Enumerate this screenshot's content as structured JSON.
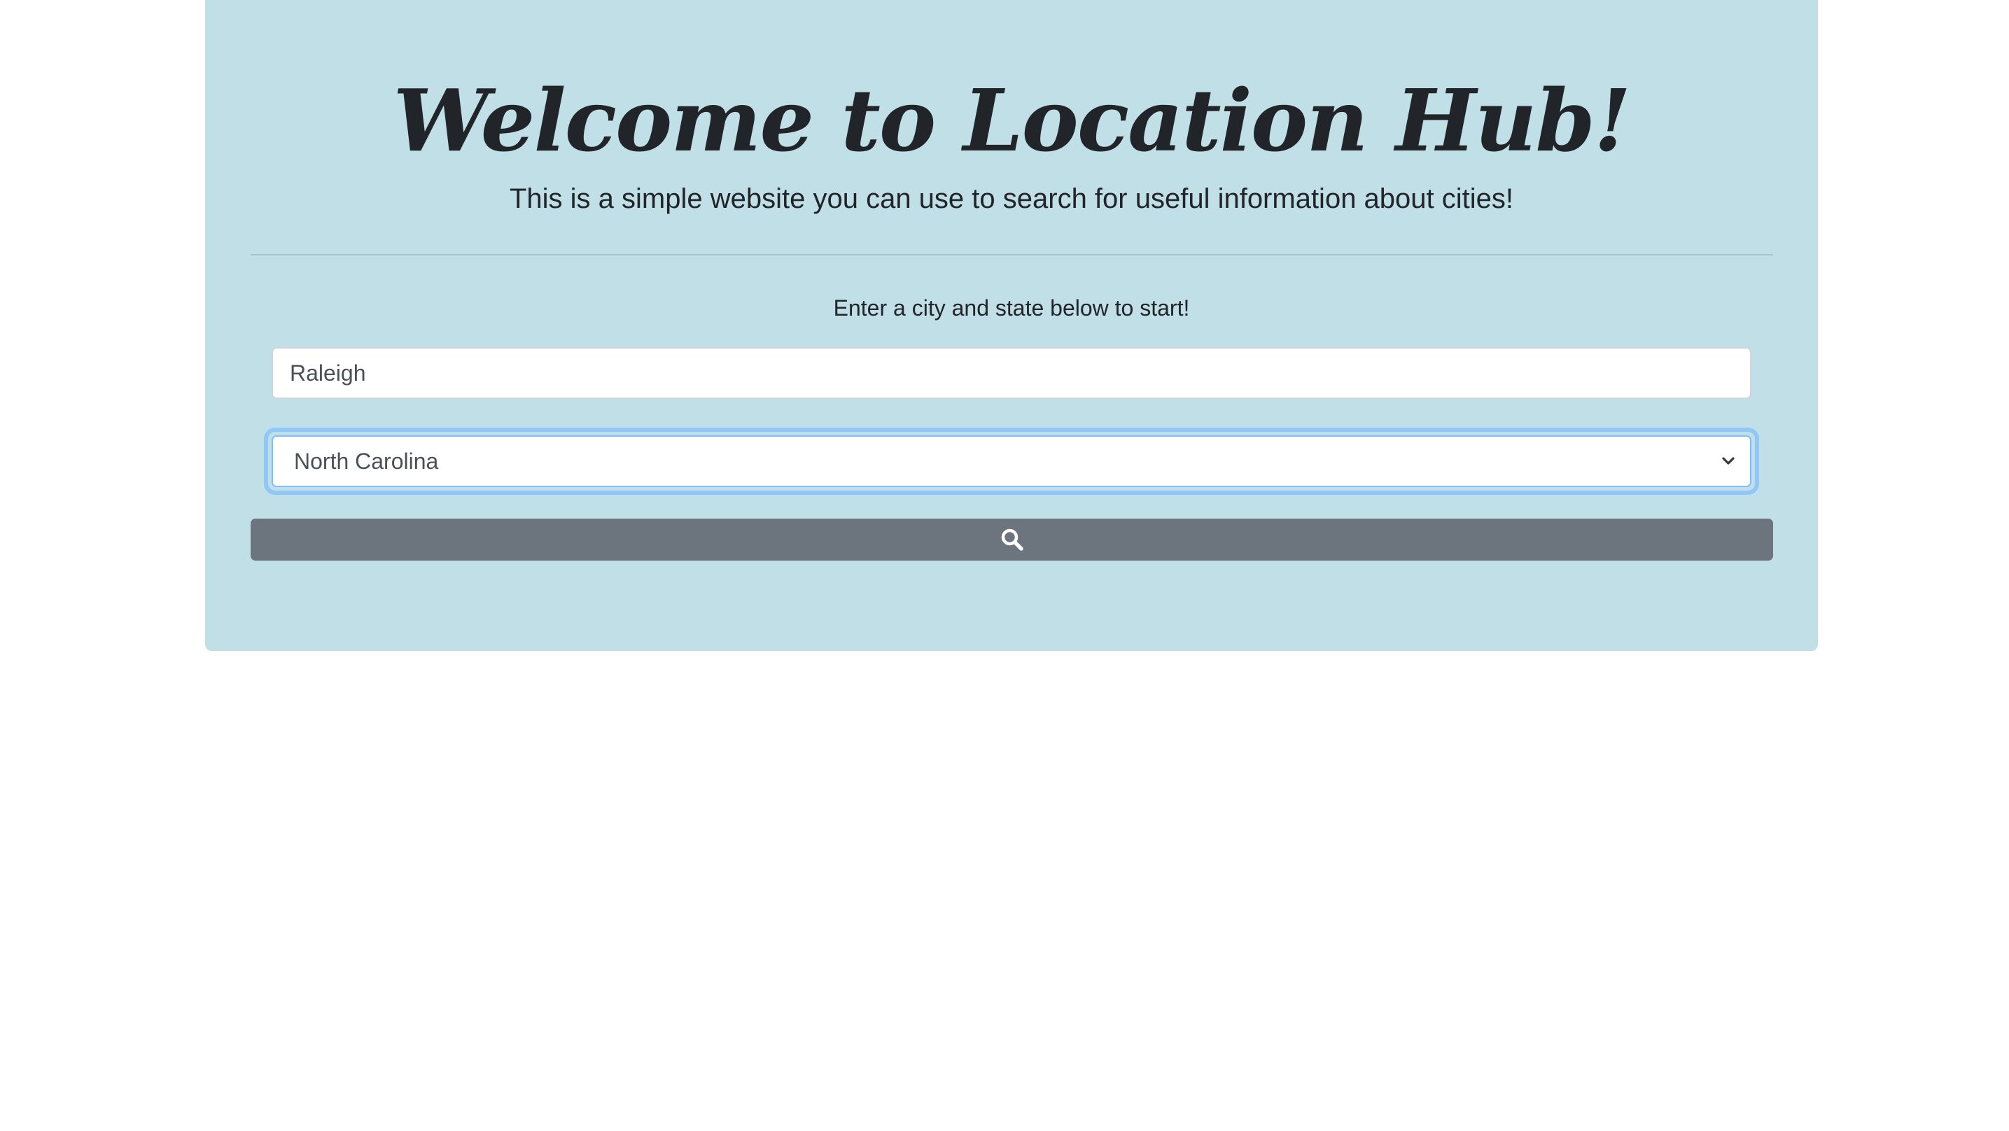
{
  "header": {
    "title": "Welcome to Location Hub!",
    "subtitle": "This is a simple website you can use to search for useful information about cities!"
  },
  "form": {
    "prompt": "Enter a city and state below to start!",
    "city_value": "Raleigh",
    "state_selected": "North Carolina",
    "search_icon": "search-icon"
  },
  "colors": {
    "hero_background": "#c1dfe6",
    "button_background": "#6c757d",
    "focus_ring": "#80bdff",
    "text": "#212529"
  }
}
